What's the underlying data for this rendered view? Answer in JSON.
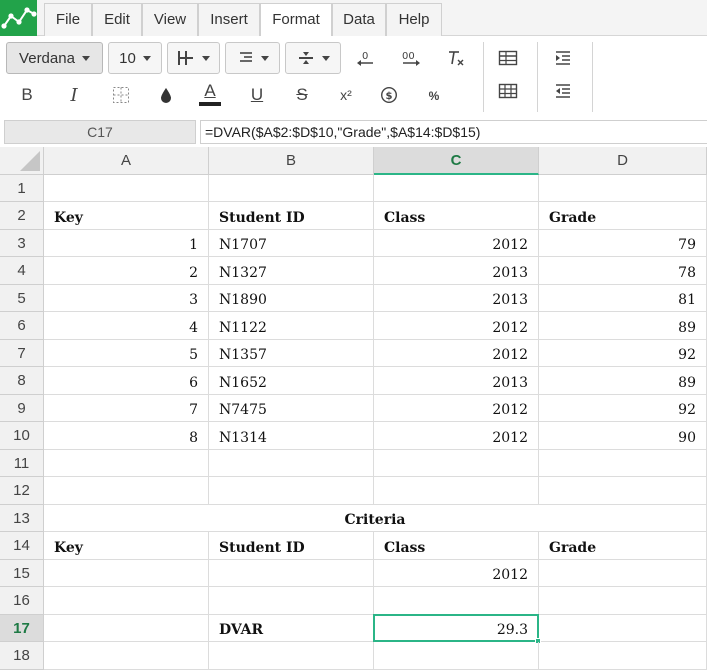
{
  "menu": {
    "items": [
      {
        "label": "File",
        "active": false
      },
      {
        "label": "Edit",
        "active": false
      },
      {
        "label": "View",
        "active": false
      },
      {
        "label": "Insert",
        "active": false
      },
      {
        "label": "Format",
        "active": true
      },
      {
        "label": "Data",
        "active": false
      },
      {
        "label": "Help",
        "active": false
      }
    ]
  },
  "toolbar": {
    "font_family": "Verdana",
    "font_size": "10",
    "icons_row1": [
      "borders-icon",
      "align-icon",
      "valign-icon",
      "decrease-decimal-icon",
      "increase-decimal-icon",
      "clear-format-icon",
      "table-icon",
      "indent-icon"
    ],
    "icons_row2": [
      "bold-icon",
      "italic-icon",
      "cell-border-icon",
      "fill-color-icon",
      "text-color-icon",
      "underline-icon",
      "strikethrough-icon",
      "superscript-icon",
      "currency-icon",
      "percent-icon",
      "table-grid-icon",
      "outdent-icon"
    ],
    "glyphs": {
      "bold": "B",
      "italic": "I",
      "text_color": "A",
      "underline": "U",
      "strike": "S",
      "super": "x²",
      "currency": "$",
      "percent": "%"
    },
    "colors": {
      "text_color_bar": "#222222",
      "fill_icon": "#333333"
    }
  },
  "formula_bar": {
    "cell_ref": "C17",
    "formula": "=DVAR($A$2:$D$10,\"Grade\",$A$14:$D$15)"
  },
  "grid": {
    "columns": [
      "A",
      "B",
      "C",
      "D"
    ],
    "selected_column": "C",
    "selected_row": "17",
    "rows": [
      {
        "n": "1",
        "cells": [
          "",
          "",
          "",
          ""
        ]
      },
      {
        "n": "2",
        "cells": [
          "Key",
          "Student ID",
          "Class",
          "Grade"
        ]
      },
      {
        "n": "3",
        "cells": [
          "1",
          "N1707",
          "2012",
          "79"
        ]
      },
      {
        "n": "4",
        "cells": [
          "2",
          "N1327",
          "2013",
          "78"
        ]
      },
      {
        "n": "5",
        "cells": [
          "3",
          "N1890",
          "2013",
          "81"
        ]
      },
      {
        "n": "6",
        "cells": [
          "4",
          "N1122",
          "2012",
          "89"
        ]
      },
      {
        "n": "7",
        "cells": [
          "5",
          "N1357",
          "2012",
          "92"
        ]
      },
      {
        "n": "8",
        "cells": [
          "6",
          "N1652",
          "2013",
          "89"
        ]
      },
      {
        "n": "9",
        "cells": [
          "7",
          "N7475",
          "2012",
          "92"
        ]
      },
      {
        "n": "10",
        "cells": [
          "8",
          "N1314",
          "2012",
          "90"
        ]
      },
      {
        "n": "11",
        "cells": [
          "",
          "",
          "",
          ""
        ]
      },
      {
        "n": "12",
        "cells": [
          "",
          "",
          "",
          ""
        ]
      },
      {
        "n": "13",
        "merged": "Criteria"
      },
      {
        "n": "14",
        "cells": [
          "Key",
          "Student ID",
          "Class",
          "Grade"
        ]
      },
      {
        "n": "15",
        "cells": [
          "",
          "",
          "2012",
          ""
        ]
      },
      {
        "n": "16",
        "cells": [
          "",
          "",
          "",
          ""
        ]
      },
      {
        "n": "17",
        "cells": [
          "",
          "DVAR",
          "29.3",
          ""
        ]
      },
      {
        "n": "18",
        "cells": [
          "",
          "",
          "",
          ""
        ]
      }
    ]
  },
  "colors": {
    "accent": "#2bb587",
    "logo": "#22a34a"
  }
}
